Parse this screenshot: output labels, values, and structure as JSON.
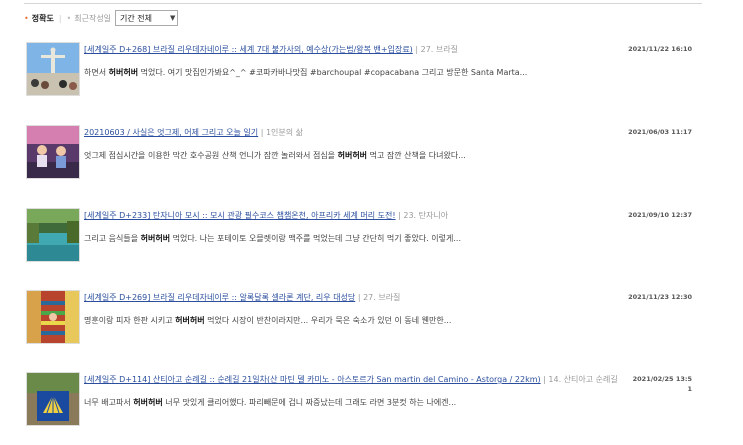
{
  "sort": {
    "accuracy_label": "정확도",
    "recent_label": "최근작성일",
    "period_select_value": "기간 전체"
  },
  "results": [
    {
      "title_link": "[세계일주 D+268] 브라질 리우데자네이루 :: 세계 7대 불가사의, 예수상(가는법/왕복 밴+입장료)",
      "meta": "| 27. 브라질",
      "date": "2021/11/22 16:10",
      "date_extra": "",
      "snippet_pre": "하면서 ",
      "snippet_bold": "허버허버",
      "snippet_post": " 먹었다. 여기 맛집인가봐요^_^ #코파카바나맛집 #barchoupal #copacabana 그리고 방문한 Santa Marta...",
      "thumb": "statue"
    },
    {
      "title_link": "20210603 / 사실은 엇그제, 어제 그리고 오늘 일기",
      "meta": "| 1인분의 삶",
      "date": "2021/06/03 11:17",
      "date_extra": "",
      "snippet_pre": "엇그제 점심시간을 이용한 막간 호수공원 산책 언니가 잠깐 놀러와서 점심을 ",
      "snippet_bold": "허버허버",
      "snippet_post": " 먹고 잠깐 산책을 다녀왔다...",
      "thumb": "people"
    },
    {
      "title_link": "[세계일주 D+233] 탄자니아 모시 :: 모시 관광 필수코스 챔챔온천, 아프리카 세계 머리 도전!",
      "meta": "| 23. 탄자니아",
      "date": "2021/09/10 12:37",
      "date_extra": "",
      "snippet_pre": "그리고 음식들을 ",
      "snippet_bold": "허버허버",
      "snippet_post": " 먹었다. 나는 포테이토 오믈렛이랑 맥주를 먹었는데 그냥 간단히 먹기 좋았다. 이렇게...",
      "thumb": "spring"
    },
    {
      "title_link": "[세계일주 D+269] 브라질 리우데자네이루 :: 알록달록 셀라론 계단, 리우 대성당",
      "meta": "| 27. 브라질",
      "date": "2021/11/23 12:30",
      "date_extra": "",
      "snippet_pre": "명훈이랑 피자 한판 시키고 ",
      "snippet_bold": "허버허버",
      "snippet_post": " 먹었다 시장이 반찬이라지만... 우리가 묵은 숙소가 있던 이 동네 웬만한...",
      "thumb": "stairs"
    },
    {
      "title_link": "[세계일주 D+114] 산티아고 순례길 :: 순례길 21일차(산 마틴 델 카미노 - 아스토르가 San martin del Camino - Astorga / 22km)",
      "meta": "| 14. 산티아고 순례길",
      "date": "2021/02/25 13:5",
      "date_extra": "1",
      "snippet_pre": "너무 배고파서 ",
      "snippet_bold": "허버허버",
      "snippet_post": " 너무 맛있게 클리어했다. 파리빼문에 겁니 짜증났는데 그래도 라면 3분컷 하는 나에겐...",
      "thumb": "shell"
    }
  ],
  "colors": {
    "link": "#2b4f9e",
    "bullet": "#e8743b"
  }
}
